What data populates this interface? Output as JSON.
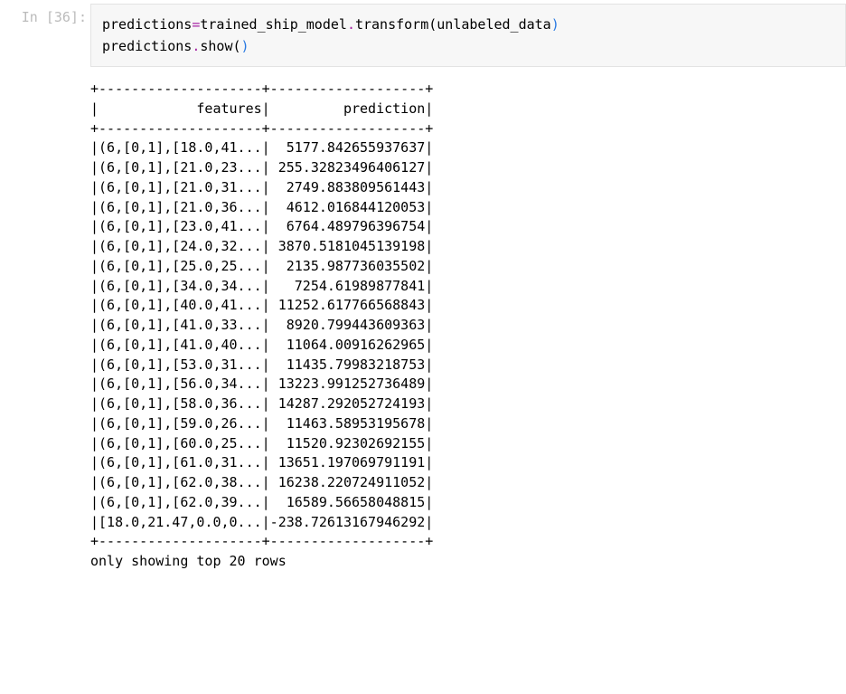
{
  "prompt": "In [36]:",
  "code": {
    "line1": {
      "var": "predictions",
      "eq": "=",
      "obj": "trained_ship_model",
      "dot": ".",
      "method": "transform",
      "open": "(",
      "arg": "unlabeled_data",
      "close": ")"
    },
    "line2": {
      "obj": "predictions",
      "dot": ".",
      "method": "show",
      "open": "(",
      "close": ")"
    }
  },
  "output": {
    "topbar": "+--------------------+-------------------+",
    "header": "|            features|         prediction|",
    "midbar": "+--------------------+-------------------+",
    "rows": [
      "|(6,[0,1],[18.0,41...|  5177.842655937637|",
      "|(6,[0,1],[21.0,23...| 255.32823496406127|",
      "|(6,[0,1],[21.0,31...|  2749.883809561443|",
      "|(6,[0,1],[21.0,36...|  4612.016844120053|",
      "|(6,[0,1],[23.0,41...|  6764.489796396754|",
      "|(6,[0,1],[24.0,32...| 3870.5181045139198|",
      "|(6,[0,1],[25.0,25...|  2135.987736035502|",
      "|(6,[0,1],[34.0,34...|   7254.61989877841|",
      "|(6,[0,1],[40.0,41...| 11252.617766568843|",
      "|(6,[0,1],[41.0,33...|  8920.799443609363|",
      "|(6,[0,1],[41.0,40...|  11064.00916262965|",
      "|(6,[0,1],[53.0,31...|  11435.79983218753|",
      "|(6,[0,1],[56.0,34...| 13223.991252736489|",
      "|(6,[0,1],[58.0,36...| 14287.292052724193|",
      "|(6,[0,1],[59.0,26...|  11463.58953195678|",
      "|(6,[0,1],[60.0,25...|  11520.92302692155|",
      "|(6,[0,1],[61.0,31...| 13651.197069791191|",
      "|(6,[0,1],[62.0,38...| 16238.220724911052|",
      "|(6,[0,1],[62.0,39...|  16589.56658048815|",
      "|[18.0,21.47,0.0,0...|-238.72613167946292|"
    ],
    "botbar": "+--------------------+-------------------+",
    "footer": "only showing top 20 rows"
  }
}
